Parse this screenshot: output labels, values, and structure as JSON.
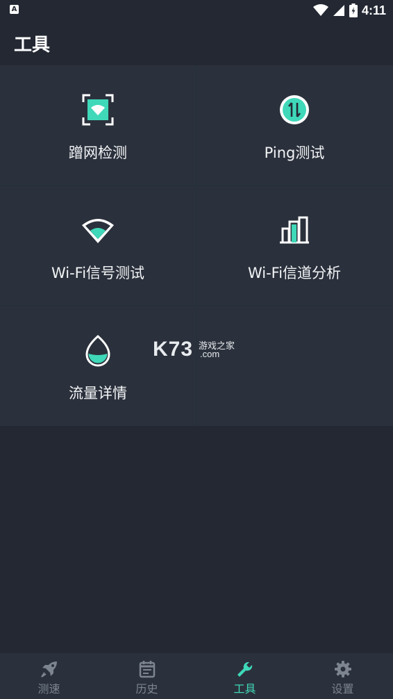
{
  "status_bar": {
    "time": "4:11",
    "notification_glyph": "A"
  },
  "header": {
    "title": "工具"
  },
  "tools": [
    {
      "label": "蹭网检测",
      "icon": "scan-wifi-icon"
    },
    {
      "label": "Ping测试",
      "icon": "ping-arrows-icon"
    },
    {
      "label": "Wi-Fi信号测试",
      "icon": "wifi-signal-icon"
    },
    {
      "label": "Wi-Fi信道分析",
      "icon": "channel-bars-icon"
    },
    {
      "label": "流量详情",
      "icon": "data-drop-icon"
    }
  ],
  "watermark": {
    "brand": "K73",
    "tagline": "游戏之家",
    "domain": ".com"
  },
  "nav": {
    "items": [
      {
        "label": "测速",
        "icon": "rocket-icon"
      },
      {
        "label": "历史",
        "icon": "calendar-icon"
      },
      {
        "label": "工具",
        "icon": "wrench-icon",
        "active": true
      },
      {
        "label": "设置",
        "icon": "gear-icon"
      }
    ]
  },
  "colors": {
    "background": "#232833",
    "card": "#2b313c",
    "accent": "#3fd8b9",
    "inactive": "#7c8590"
  }
}
